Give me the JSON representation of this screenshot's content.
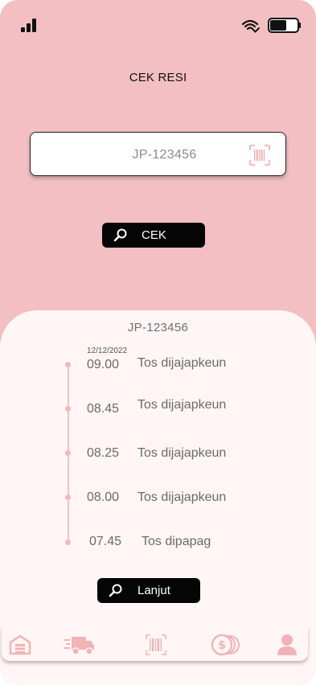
{
  "header": {
    "title": "CEK RESI"
  },
  "search": {
    "value": "JP-123456",
    "button_label": "CEK"
  },
  "result": {
    "receipt_number": "JP-123456",
    "date": "12/12/2022",
    "events": [
      {
        "time": "09.00",
        "status": "Tos dijajapkeun"
      },
      {
        "time": "08.45",
        "status": "Tos dijajapkeun"
      },
      {
        "time": "08.25",
        "status": "Tos dijajapkeun"
      },
      {
        "time": "08.00",
        "status": "Tos dijajapkeun"
      },
      {
        "time": "07.45",
        "status": "Tos dipapag"
      }
    ],
    "next_button_label": "Lanjut"
  },
  "nav": {
    "items": [
      {
        "icon": "warehouse-icon"
      },
      {
        "icon": "delivery-truck-icon"
      },
      {
        "icon": "barcode-scan-icon"
      },
      {
        "icon": "money-icon"
      },
      {
        "icon": "profile-icon"
      }
    ]
  },
  "colors": {
    "background": "#f3bfc2",
    "sheet": "#fff6f5",
    "button": "#050505",
    "accent_pink": "#f0b9bb"
  }
}
